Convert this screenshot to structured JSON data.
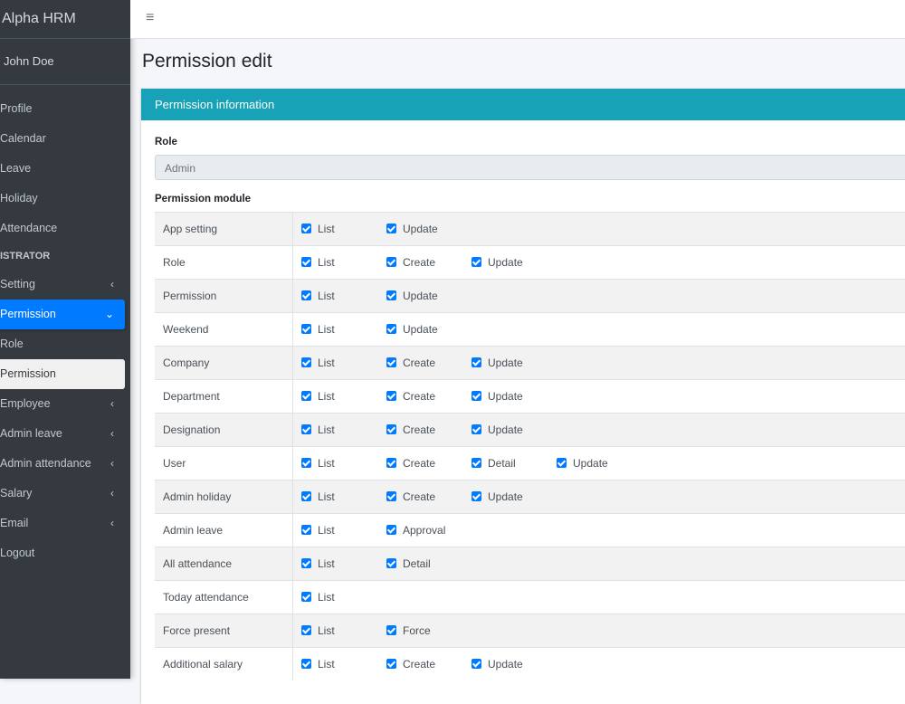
{
  "app": {
    "brand": "Alpha HRM",
    "user": "John Doe"
  },
  "sidebar": {
    "items": [
      {
        "label": "Profile",
        "type": "item"
      },
      {
        "label": "Calendar",
        "type": "item"
      },
      {
        "label": "Leave",
        "type": "item"
      },
      {
        "label": "Holiday",
        "type": "item"
      },
      {
        "label": "Attendance",
        "type": "item"
      },
      {
        "label": "ISTRATOR",
        "type": "header"
      },
      {
        "label": "Setting",
        "type": "item",
        "caret": "‹"
      },
      {
        "label": "Permission",
        "type": "active",
        "caret": "⌄"
      },
      {
        "label": "Role",
        "type": "item"
      },
      {
        "label": "Permission",
        "type": "sub-active"
      },
      {
        "label": "Employee",
        "type": "item",
        "caret": "‹"
      },
      {
        "label": "Admin leave",
        "type": "item",
        "caret": "‹"
      },
      {
        "label": "Admin attendance",
        "type": "item",
        "caret": "‹"
      },
      {
        "label": "Salary",
        "type": "item",
        "caret": "‹"
      },
      {
        "label": "Email",
        "type": "item",
        "caret": "‹"
      },
      {
        "label": "Logout",
        "type": "item"
      }
    ]
  },
  "topbar": {
    "menu_icon": "≡"
  },
  "page": {
    "title": "Permission edit"
  },
  "card": {
    "header": "Permission information",
    "role_label": "Role",
    "role_value": "Admin",
    "module_label": "Permission module"
  },
  "modules": [
    {
      "name": "App setting",
      "perms": [
        "List",
        "Update"
      ]
    },
    {
      "name": "Role",
      "perms": [
        "List",
        "Create",
        "Update"
      ]
    },
    {
      "name": "Permission",
      "perms": [
        "List",
        "Update"
      ]
    },
    {
      "name": "Weekend",
      "perms": [
        "List",
        "Update"
      ]
    },
    {
      "name": "Company",
      "perms": [
        "List",
        "Create",
        "Update"
      ]
    },
    {
      "name": "Department",
      "perms": [
        "List",
        "Create",
        "Update"
      ]
    },
    {
      "name": "Designation",
      "perms": [
        "List",
        "Create",
        "Update"
      ]
    },
    {
      "name": "User",
      "perms": [
        "List",
        "Create",
        "Detail",
        "Update"
      ]
    },
    {
      "name": "Admin holiday",
      "perms": [
        "List",
        "Create",
        "Update"
      ]
    },
    {
      "name": "Admin leave",
      "perms": [
        "List",
        "Approval"
      ]
    },
    {
      "name": "All attendance",
      "perms": [
        "List",
        "Detail"
      ]
    },
    {
      "name": "Today attendance",
      "perms": [
        "List"
      ]
    },
    {
      "name": "Force present",
      "perms": [
        "List",
        "Force"
      ]
    },
    {
      "name": "Additional salary",
      "perms": [
        "List",
        "Create",
        "Update"
      ]
    }
  ],
  "colors": {
    "accent": "#007bff",
    "card_header": "#17a2b8",
    "sidebar": "#343a40"
  }
}
